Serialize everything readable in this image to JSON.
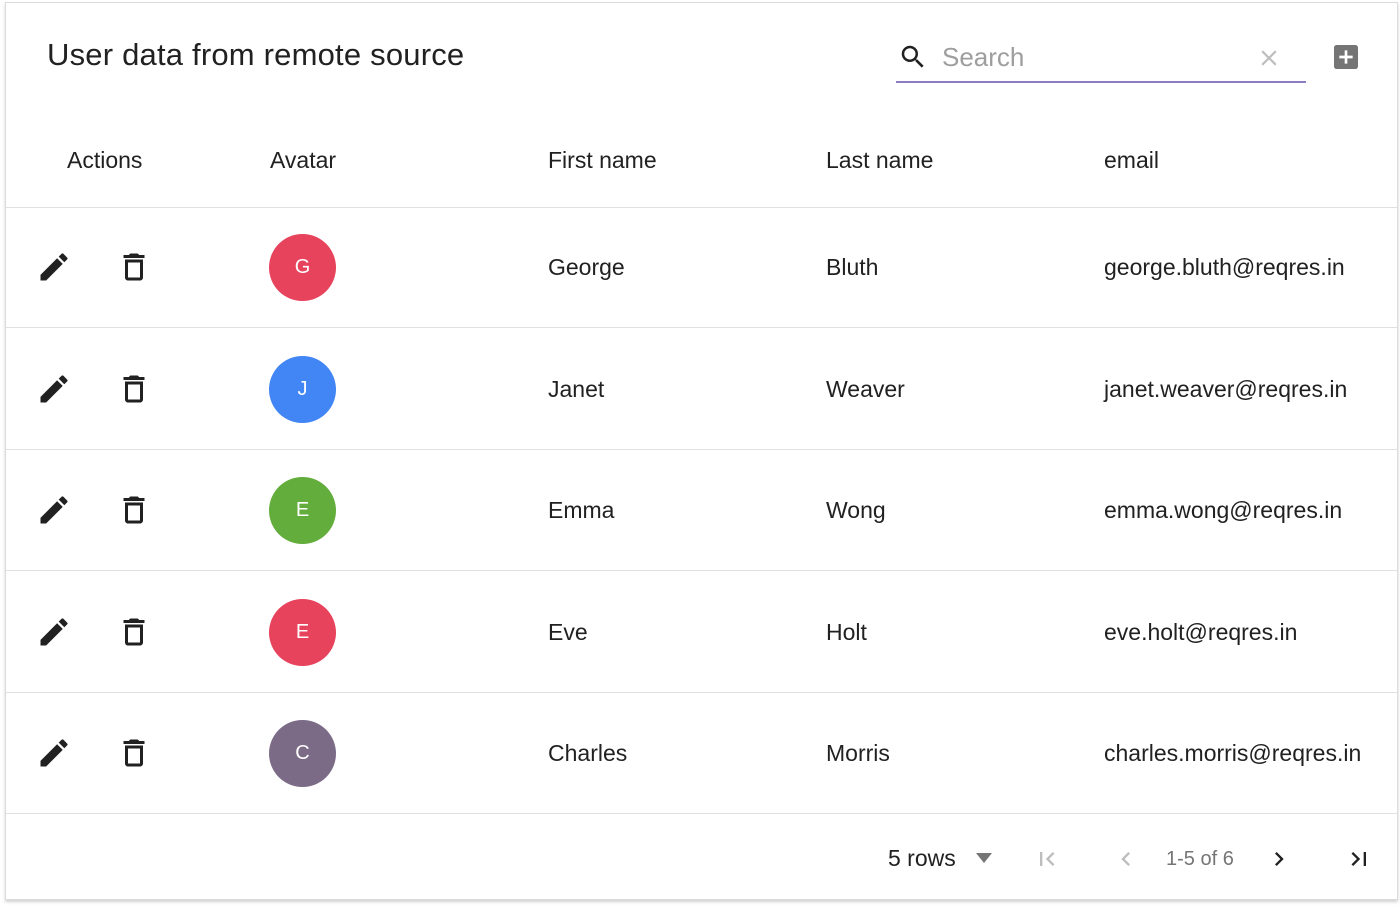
{
  "table": {
    "title": "User data from remote source",
    "search": {
      "placeholder": "Search",
      "value": ""
    },
    "columns": [
      "Actions",
      "Avatar",
      "First name",
      "Last name",
      "email"
    ],
    "rows": [
      {
        "initial": "G",
        "avatar_color": "#e8435d",
        "first_name": "George",
        "last_name": "Bluth",
        "email": "george.bluth@reqres.in"
      },
      {
        "initial": "J",
        "avatar_color": "#4285f4",
        "first_name": "Janet",
        "last_name": "Weaver",
        "email": "janet.weaver@reqres.in"
      },
      {
        "initial": "E",
        "avatar_color": "#63ad3c",
        "first_name": "Emma",
        "last_name": "Wong",
        "email": "emma.wong@reqres.in"
      },
      {
        "initial": "E",
        "avatar_color": "#e8435d",
        "first_name": "Eve",
        "last_name": "Holt",
        "email": "eve.holt@reqres.in"
      },
      {
        "initial": "C",
        "avatar_color": "#7c6b87",
        "first_name": "Charles",
        "last_name": "Morris",
        "email": "charles.morris@reqres.in"
      }
    ]
  },
  "pagination": {
    "rows_per_page_label": "5 rows",
    "page_info": "1-5 of 6"
  },
  "icons": {
    "search": "search-icon",
    "clear": "close-icon",
    "add": "add-box-icon",
    "edit": "pencil-icon",
    "delete": "trash-icon",
    "first": "first-page-icon",
    "prev": "chevron-left-icon",
    "next": "chevron-right-icon",
    "last": "last-page-icon"
  },
  "colors": {
    "search_underline": "#8e7cc3",
    "icon_dark": "#212121",
    "icon_disabled": "#bdbdbd"
  }
}
